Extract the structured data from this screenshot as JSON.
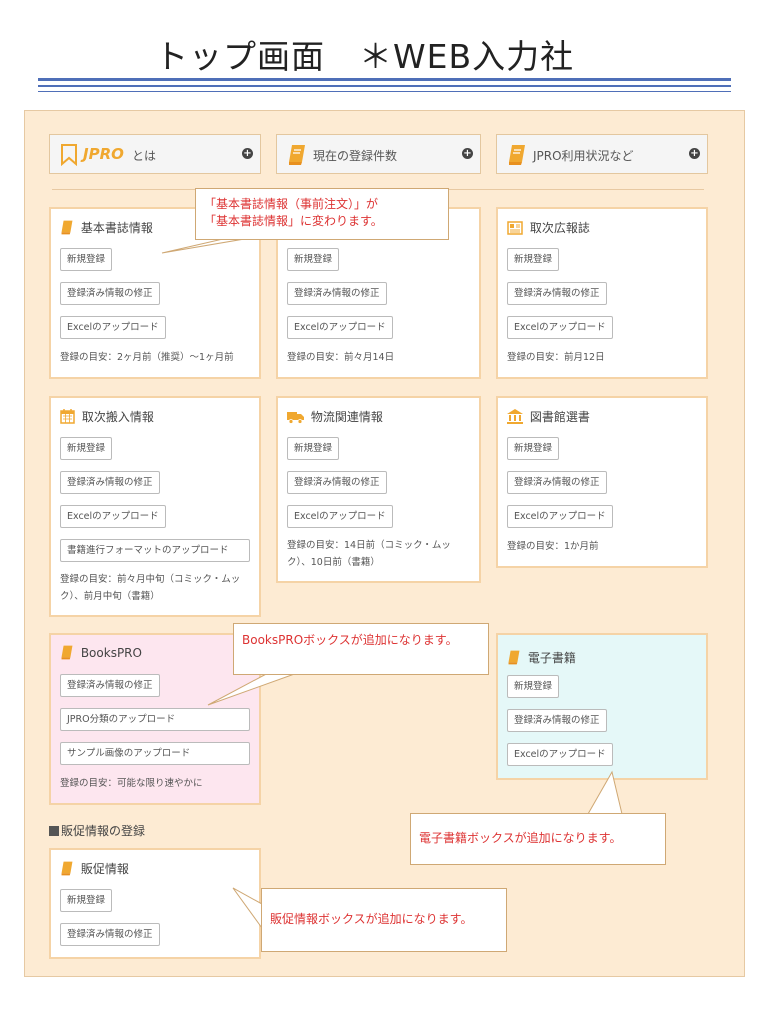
{
  "title": "トップ画面　＊WEB入力社",
  "tabs": [
    {
      "label": "とは",
      "logo": "JPRO",
      "icon": "bookmark-icon"
    },
    {
      "label": "現在の登録件数",
      "icon": "book-icon"
    },
    {
      "label": "JPRO利用状況など",
      "icon": "book-icon"
    }
  ],
  "cards": {
    "basic": {
      "title": "基本書誌情報",
      "icon": "book-icon",
      "buttons": [
        "新規登録",
        "登録済み情報の修正",
        "Excelのアップロード"
      ],
      "hint": "登録の目安：2ヶ月前（推奨）～1ヶ月前"
    },
    "middle": {
      "buttons": [
        "新規登録",
        "登録済み情報の修正",
        "Excelのアップロード"
      ],
      "hint": "登録の目安：前々月14日"
    },
    "koho": {
      "title": "取次広報誌",
      "icon": "newspaper-icon",
      "buttons": [
        "新規登録",
        "登録済み情報の修正",
        "Excelのアップロード"
      ],
      "hint": "登録の目安：前月12日"
    },
    "hannyu": {
      "title": "取次搬入情報",
      "icon": "calendar-icon",
      "buttons": [
        "新規登録",
        "登録済み情報の修正",
        "Excelのアップロード",
        "書籍進行フォーマットのアップロード"
      ],
      "hint": "登録の目安：前々月中旬（コミック・ムック）、前月中旬（書籍）"
    },
    "butsuryu": {
      "title": "物流関連情報",
      "icon": "truck-icon",
      "buttons": [
        "新規登録",
        "登録済み情報の修正",
        "Excelのアップロード"
      ],
      "hint": "登録の目安：14日前（コミック・ムック）、10日前（書籍）"
    },
    "toshokan": {
      "title": "図書館選書",
      "icon": "library-icon",
      "buttons": [
        "新規登録",
        "登録済み情報の修正",
        "Excelのアップロード"
      ],
      "hint": "登録の目安：1か月前"
    },
    "bookspro": {
      "title": "BooksPRO",
      "icon": "book-icon",
      "buttons": [
        "登録済み情報の修正",
        "JPRO分類のアップロード",
        "サンプル画像のアップロード"
      ],
      "hint": "登録の目安：可能な限り速やかに"
    },
    "denshi": {
      "title": "電子書籍",
      "icon": "book-icon",
      "buttons": [
        "新規登録",
        "登録済み情報の修正",
        "Excelのアップロード"
      ]
    },
    "hansoku": {
      "title": "販促情報",
      "icon": "book-icon",
      "buttons": [
        "新規登録",
        "登録済み情報の修正"
      ]
    }
  },
  "section_heading": "販促情報の登録",
  "callouts": {
    "rename_line1": "「基本書誌情報（事前注文）」が",
    "rename_line2": "「基本書誌情報」に変わります。",
    "bookspro": "BooksPROボックスが追加になります。",
    "denshi": "電子書籍ボックスが追加になります。",
    "hansoku": "販促情報ボックスが追加になります。"
  },
  "colors": {
    "accent": "#f0a830",
    "rule": "#4f6fb8",
    "panel": "#fdebd3",
    "card_border": "#f5d3a6",
    "callout_text": "#dd3333"
  }
}
